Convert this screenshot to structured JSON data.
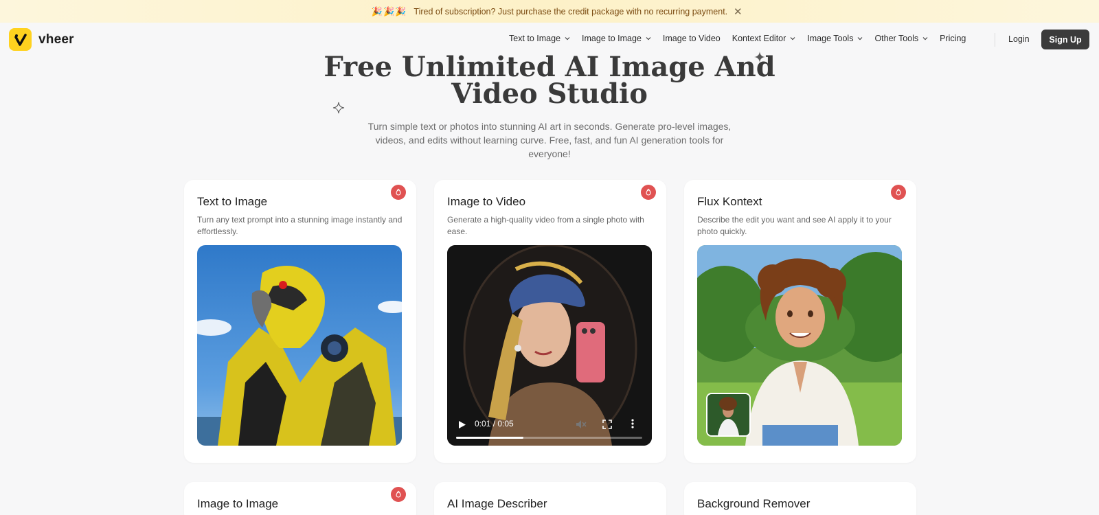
{
  "banner": {
    "emoji": "🎉🎉🎉",
    "message": "Tired of subscription? Just purchase the credit package with no recurring payment.",
    "close_symbol": "✕"
  },
  "brand": {
    "name": "vheer",
    "accent": "#ffd21f"
  },
  "nav": {
    "items": [
      {
        "label": "Text to Image",
        "dropdown": true
      },
      {
        "label": "Image to Image",
        "dropdown": true
      },
      {
        "label": "Image to Video",
        "dropdown": false
      },
      {
        "label": "Kontext Editor",
        "dropdown": true
      },
      {
        "label": "Image Tools",
        "dropdown": true
      },
      {
        "label": "Other Tools",
        "dropdown": true
      },
      {
        "label": "Pricing",
        "dropdown": false
      }
    ],
    "login": "Login",
    "signup": "Sign Up"
  },
  "hero": {
    "title_line1": "Free Unlimited AI Image And",
    "title_line2": "Video Studio",
    "subtitle": "Turn simple text or photos into stunning AI art in seconds. Generate pro-level images, videos, and edits without learning curve. Free, fast, and fun AI generation tools for everyone!"
  },
  "cards": [
    {
      "title": "Text to Image",
      "desc": "Turn any text prompt into a stunning image instantly and effortlessly.",
      "hot": true,
      "media": "robot-eagle-image"
    },
    {
      "title": "Image to Video",
      "desc": "Generate a high-quality video from a single photo with ease.",
      "hot": true,
      "media": "girl-with-pearl-earring-video"
    },
    {
      "title": "Flux Kontext",
      "desc": "Describe the edit you want and see AI apply it to your photo quickly.",
      "hot": true,
      "media": "anime-boy-image"
    },
    {
      "title": "Image to Image",
      "hot": true
    },
    {
      "title": "AI Image Describer",
      "hot": false
    },
    {
      "title": "Background Remover",
      "hot": false
    }
  ],
  "video": {
    "time": "0:01 / 0:05",
    "progress": 0.36
  },
  "colors": {
    "hot_badge": "#e05252",
    "signup_bg": "#3b3b3b",
    "banner_text": "#7a4a10"
  }
}
